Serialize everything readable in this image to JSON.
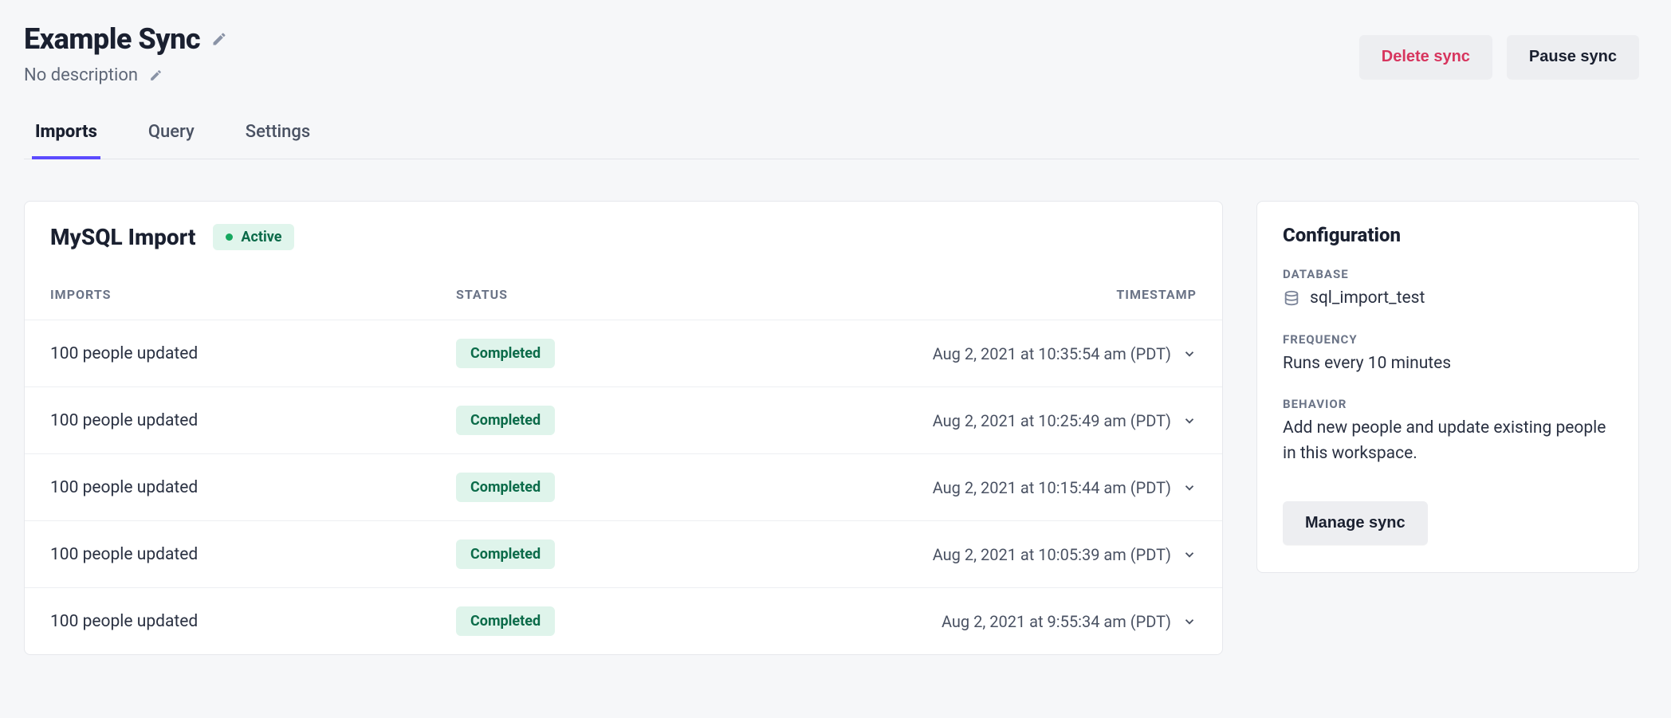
{
  "header": {
    "title": "Example Sync",
    "description": "No description",
    "delete_label": "Delete sync",
    "pause_label": "Pause sync"
  },
  "tabs": [
    {
      "label": "Imports",
      "active": true
    },
    {
      "label": "Query",
      "active": false
    },
    {
      "label": "Settings",
      "active": false
    }
  ],
  "imports_panel": {
    "title": "MySQL Import",
    "status_badge": "Active",
    "columns": {
      "imports": "IMPORTS",
      "status": "STATUS",
      "timestamp": "TIMESTAMP"
    },
    "rows": [
      {
        "imports": "100 people updated",
        "status": "Completed",
        "timestamp": "Aug 2, 2021 at 10:35:54 am (PDT)"
      },
      {
        "imports": "100 people updated",
        "status": "Completed",
        "timestamp": "Aug 2, 2021 at 10:25:49 am (PDT)"
      },
      {
        "imports": "100 people updated",
        "status": "Completed",
        "timestamp": "Aug 2, 2021 at 10:15:44 am (PDT)"
      },
      {
        "imports": "100 people updated",
        "status": "Completed",
        "timestamp": "Aug 2, 2021 at 10:05:39 am (PDT)"
      },
      {
        "imports": "100 people updated",
        "status": "Completed",
        "timestamp": "Aug 2, 2021 at 9:55:34 am (PDT)"
      }
    ]
  },
  "config": {
    "title": "Configuration",
    "database_label": "DATABASE",
    "database_value": "sql_import_test",
    "frequency_label": "FREQUENCY",
    "frequency_value": "Runs every 10 minutes",
    "behavior_label": "BEHAVIOR",
    "behavior_value": "Add new people and update existing people in this workspace.",
    "manage_label": "Manage sync"
  }
}
